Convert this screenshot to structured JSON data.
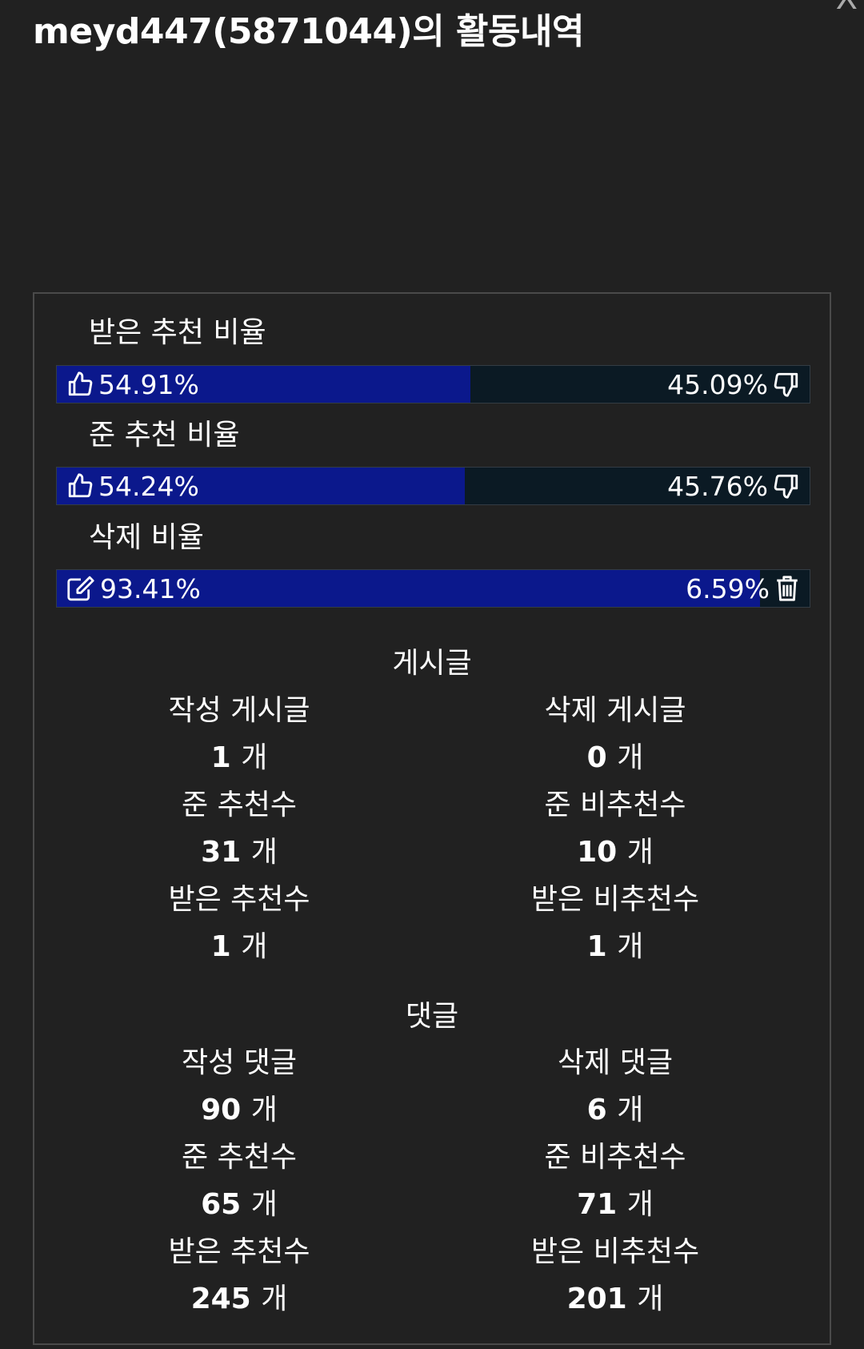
{
  "header": {
    "title": "meyd447(5871044)의 활동내역",
    "close_label": "X"
  },
  "ratios": [
    {
      "label": "받은 추천 비율",
      "left_value": "54.91%",
      "right_value": "45.09%",
      "fill_percent": 54.91,
      "left_icon": "thumbs-up-icon",
      "right_icon": "thumbs-down-icon"
    },
    {
      "label": "준 추천 비율",
      "left_value": "54.24%",
      "right_value": "45.76%",
      "fill_percent": 54.24,
      "left_icon": "thumbs-up-icon",
      "right_icon": "thumbs-down-icon"
    },
    {
      "label": "삭제 비율",
      "left_value": "93.41%",
      "right_value": "6.59%",
      "fill_percent": 93.41,
      "left_icon": "edit-icon",
      "right_icon": "trash-icon"
    }
  ],
  "posts": {
    "title": "게시글",
    "written_label": "작성 게시글",
    "written_value": "1",
    "written_unit": "개",
    "deleted_label": "삭제 게시글",
    "deleted_value": "0",
    "deleted_unit": "개",
    "given_up_label": "준 추천수",
    "given_up_value": "31",
    "given_up_unit": "개",
    "given_down_label": "준 비추천수",
    "given_down_value": "10",
    "given_down_unit": "개",
    "recv_up_label": "받은 추천수",
    "recv_up_value": "1",
    "recv_up_unit": "개",
    "recv_down_label": "받은 비추천수",
    "recv_down_value": "1",
    "recv_down_unit": "개"
  },
  "comments": {
    "title": "댓글",
    "written_label": "작성 댓글",
    "written_value": "90",
    "written_unit": "개",
    "deleted_label": "삭제 댓글",
    "deleted_value": "6",
    "deleted_unit": "개",
    "given_up_label": "준 추천수",
    "given_up_value": "65",
    "given_up_unit": "개",
    "given_down_label": "준 비추천수",
    "given_down_value": "71",
    "given_down_unit": "개",
    "recv_up_label": "받은 추천수",
    "recv_up_value": "245",
    "recv_up_unit": "개",
    "recv_down_label": "받은 비추천수",
    "recv_down_value": "201",
    "recv_down_unit": "개"
  },
  "colors": {
    "background": "#212121",
    "bar_fill": "#0b188c",
    "bar_track": "#0b1a24"
  }
}
